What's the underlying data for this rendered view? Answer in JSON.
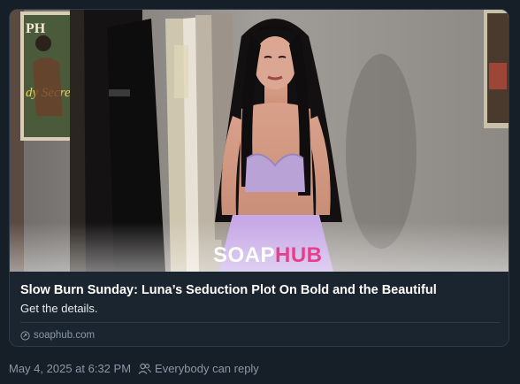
{
  "card": {
    "image_alt": "Woman with long dark hair in a lavender lace top standing in a wardrobe room",
    "watermark": {
      "part1": "SOAP",
      "part2": "HUB",
      "color1": "#ffffff",
      "color2": "#e83e8c"
    },
    "headline": "Slow Burn Sunday: Luna’s Seduction Plot On Bold and the Beautiful",
    "description": "Get the details.",
    "domain": "soaphub.com",
    "domain_icon": "link-icon"
  },
  "meta": {
    "timestamp": "May 4, 2025 at 6:32 PM",
    "reply_icon": "people-icon",
    "reply_setting": "Everybody can reply"
  },
  "colors": {
    "background": "#161e27",
    "card_border": "#2e3a47",
    "muted_text": "#8b98a5"
  }
}
